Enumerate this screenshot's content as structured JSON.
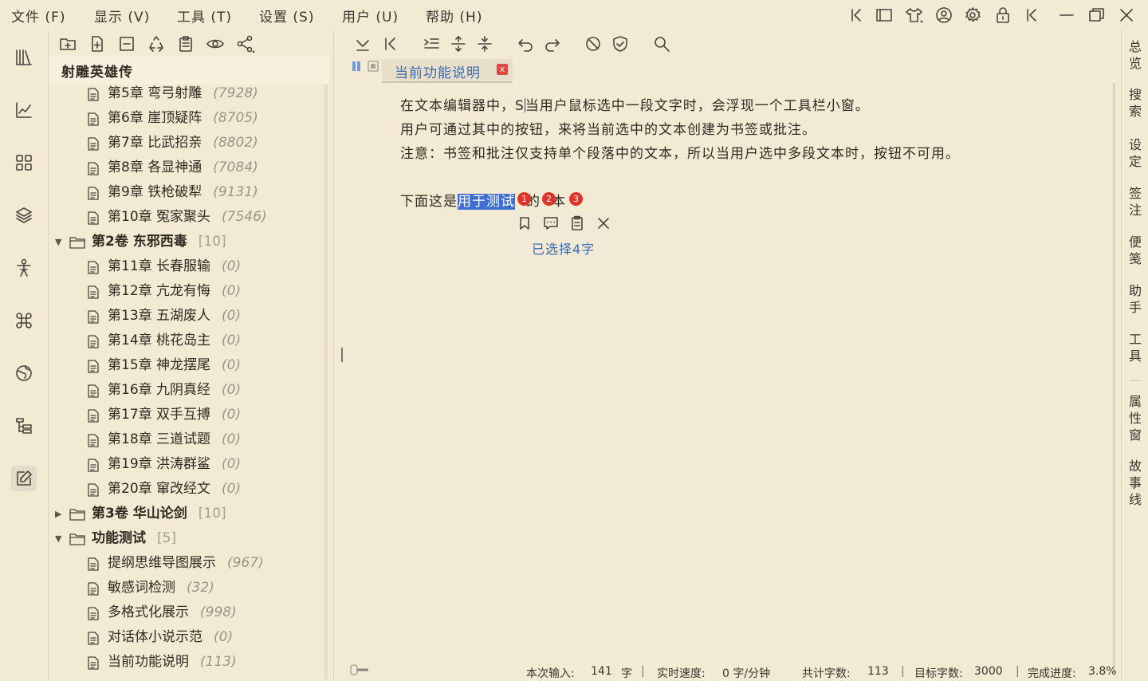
{
  "menu": [
    "文件 (F)",
    "显示 (V)",
    "工具 (T)",
    "设置 (S)",
    "用户 (U)",
    "帮助 (H)"
  ],
  "tree": {
    "title": "射雕英雄传",
    "rows": [
      {
        "kind": "doc",
        "label": "第5章 弯弓射雕",
        "count": "(7928)"
      },
      {
        "kind": "doc",
        "label": "第6章 崖顶疑阵",
        "count": "(8705)"
      },
      {
        "kind": "doc",
        "label": "第7章 比武招亲",
        "count": "(8802)"
      },
      {
        "kind": "doc",
        "label": "第8章 各显神通",
        "count": "(7084)"
      },
      {
        "kind": "doc",
        "label": "第9章 铁枪破犁",
        "count": "(9131)"
      },
      {
        "kind": "doc",
        "label": "第10章 冤家聚头",
        "count": "(7546)"
      },
      {
        "kind": "vol",
        "label": "第2卷 东邪西毒",
        "count": "[10]",
        "open": true
      },
      {
        "kind": "doc",
        "label": "第11章 长春服输",
        "count": "(0)"
      },
      {
        "kind": "doc",
        "label": "第12章 亢龙有悔",
        "count": "(0)"
      },
      {
        "kind": "doc",
        "label": "第13章 五湖废人",
        "count": "(0)"
      },
      {
        "kind": "doc",
        "label": "第14章 桃花岛主",
        "count": "(0)"
      },
      {
        "kind": "doc",
        "label": "第15章 神龙摆尾",
        "count": "(0)"
      },
      {
        "kind": "doc",
        "label": "第16章 九阴真经",
        "count": "(0)"
      },
      {
        "kind": "doc",
        "label": "第17章 双手互搏",
        "count": "(0)"
      },
      {
        "kind": "doc",
        "label": "第18章 三道试题",
        "count": "(0)"
      },
      {
        "kind": "doc",
        "label": "第19章 洪涛群鲨",
        "count": "(0)"
      },
      {
        "kind": "doc",
        "label": "第20章 窜改经文",
        "count": "(0)"
      },
      {
        "kind": "vol",
        "label": "第3卷 华山论剑",
        "count": "[10]",
        "open": false
      },
      {
        "kind": "vol",
        "label": "功能测试",
        "count": "[5]",
        "open": true
      },
      {
        "kind": "doc",
        "label": "提纲思维导图展示",
        "count": "(967)"
      },
      {
        "kind": "doc",
        "label": "敏感词检测",
        "count": "(32)"
      },
      {
        "kind": "doc",
        "label": "多格式化展示",
        "count": "(998)"
      },
      {
        "kind": "doc",
        "label": "对话体小说示范",
        "count": "(0)"
      },
      {
        "kind": "doc",
        "label": "当前功能说明",
        "count": "(113)"
      }
    ]
  },
  "tab": {
    "title": "当前功能说明",
    "close": "x"
  },
  "content": {
    "line1a": "在文本编辑器中，S",
    "line1b": "当用户鼠标选中一段文字时，会浮现一个工具栏小窗。",
    "line2": "用户可通过其中的按钮，来将当前选中的文本创建为书签或批注。",
    "line3": "注意：书签和批注仅支持单个段落中的文本，所以当用户选中多段文本时，按钮不可用。",
    "line4_pre": "下面这是",
    "line4_sel": "用于测试",
    "line4_mid": "的",
    "line4_post": "本",
    "badges": [
      "1",
      "2",
      "3"
    ]
  },
  "float_toolbar": {
    "selected": "已选择4字"
  },
  "status": {
    "input_label": "本次输入:",
    "input_value": "141",
    "input_unit": "字",
    "speed_label": "实时速度:",
    "speed_value": "0 字/分钟",
    "total_label": "共计字数:",
    "total_value": "113",
    "target_label": "目标字数:",
    "target_value": "3000",
    "progress_label": "完成进度:",
    "progress_value": "3.8%"
  },
  "rightbar": [
    "总览",
    "搜索",
    "设定",
    "签注",
    "便笺",
    "助手",
    "工具",
    "属性窗",
    "故事线"
  ],
  "colors": {
    "background": "#f3ead3",
    "accent": "#3d6bb3",
    "selection": "#3f6fd3",
    "badge": "#e0342b"
  }
}
